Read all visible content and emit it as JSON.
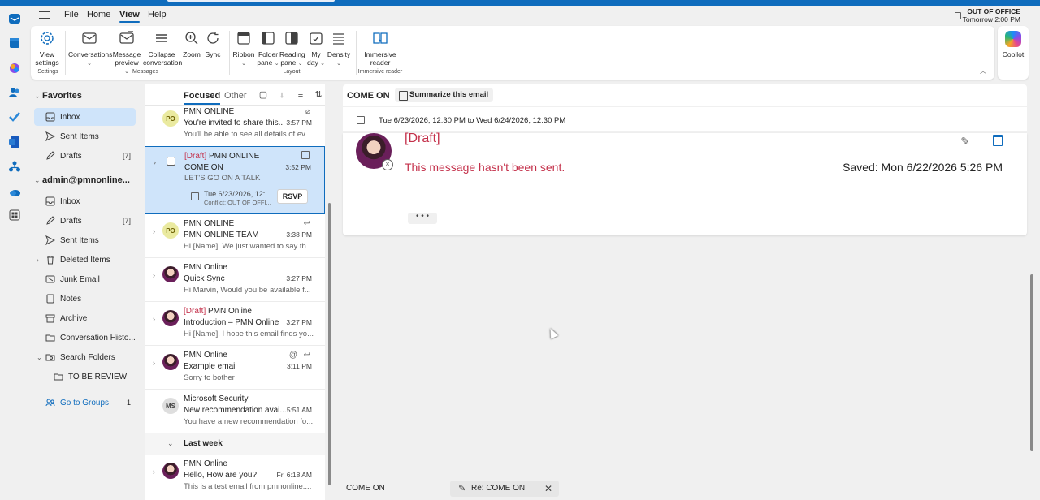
{
  "menu": {
    "items": [
      "File",
      "Home",
      "View",
      "Help"
    ],
    "active": "View"
  },
  "out_of_office": {
    "line1": "OUT OF OFFICE",
    "line2": "Tomorrow 2:00 PM"
  },
  "ribbon": {
    "buttons": {
      "view_settings": "View settings",
      "conversations": "Conversations",
      "message_preview": "Message preview",
      "collapse_conversation": "Collapse conversation",
      "zoom": "Zoom",
      "sync": "Sync",
      "ribbon": "Ribbon",
      "folder_pane": "Folder pane",
      "reading_pane": "Reading pane",
      "my_day": "My day",
      "density": "Density",
      "immersive_reader": "Immersive reader",
      "copilot": "Copilot"
    },
    "groups": {
      "settings": "Settings",
      "messages": "Messages",
      "layout": "Layout",
      "immersive": "Immersive reader"
    }
  },
  "folders": {
    "favorites_header": "Favorites",
    "favorites": [
      {
        "label": "Inbox",
        "count": ""
      },
      {
        "label": "Sent Items",
        "count": ""
      },
      {
        "label": "Drafts",
        "count": "[7]"
      }
    ],
    "account_header": "admin@pmnonline...",
    "account": [
      {
        "label": "Inbox",
        "count": ""
      },
      {
        "label": "Drafts",
        "count": "[7]"
      },
      {
        "label": "Sent Items",
        "count": ""
      },
      {
        "label": "Deleted Items",
        "count": ""
      },
      {
        "label": "Junk Email",
        "count": ""
      },
      {
        "label": "Notes",
        "count": ""
      },
      {
        "label": "Archive",
        "count": ""
      },
      {
        "label": "Conversation Histo...",
        "count": ""
      },
      {
        "label": "Search Folders",
        "count": ""
      },
      {
        "label": "TO BE REVIEW",
        "count": ""
      }
    ],
    "groups_label": "Go to Groups",
    "groups_count": "1"
  },
  "list": {
    "tabs": {
      "focused": "Focused",
      "other": "Other"
    },
    "messages": [
      {
        "draft": "",
        "from": "PMN ONLINE",
        "subject": "You're invited to share this...",
        "time": "3:57 PM",
        "preview": "You'll be able to see all details of ev...",
        "avatar": "PO"
      },
      {
        "draft": "[Draft]",
        "from": "PMN ONLINE",
        "subject": "COME ON",
        "time": "3:52 PM",
        "preview": "LET'S GO ON A TALK",
        "cal_line1": "Tue 6/23/2026, 12:...",
        "cal_line2": "Conflict: OUT OF OFFI...",
        "rsvp": "RSVP"
      },
      {
        "draft": "",
        "from": "PMN ONLINE",
        "subject": "PMN ONLINE TEAM",
        "time": "3:38 PM",
        "preview": "Hi [Name], We just wanted to say th...",
        "avatar": "PO"
      },
      {
        "draft": "",
        "from": "PMN Online",
        "subject": "Quick Sync",
        "time": "3:27 PM",
        "preview": "Hi Marvin, Would you be available f..."
      },
      {
        "draft": "[Draft]",
        "from": "PMN Online",
        "subject": "Introduction – PMN Online",
        "time": "3:27 PM",
        "preview": "Hi [Name], I hope this email finds yo..."
      },
      {
        "draft": "",
        "from": "PMN Online",
        "subject": "Example email",
        "time": "3:11 PM",
        "preview": "Sorry to bother"
      },
      {
        "draft": "",
        "from": "Microsoft Security",
        "subject": "New recommendation avai...",
        "time": "5:51 AM",
        "preview": "You have a new recommendation fo...",
        "avatar": "MS"
      },
      {
        "draft": "",
        "from": "PMN Online",
        "subject": "Hello, How are you?",
        "time": "Fri 6:18 AM",
        "preview": "This is a test email from pmnonline...."
      }
    ],
    "last_week": "Last week"
  },
  "reading": {
    "subject": "COME ON",
    "summarize": "Summarize this email",
    "event_time": "Tue 6/23/2026, 12:30 PM to Wed 6/24/2026, 12:30 PM",
    "draft_title": "[Draft]",
    "not_sent": "This message hasn't been sent.",
    "saved": "Saved: Mon 6/22/2026 5:26 PM",
    "more": "• • •"
  },
  "bottom_tabs": {
    "tab1": "COME ON",
    "tab2": "Re: COME ON"
  },
  "colors": {
    "accent": "#0f6cbd",
    "draft_red": "#c4314b",
    "selection": "#cfe4fa"
  }
}
